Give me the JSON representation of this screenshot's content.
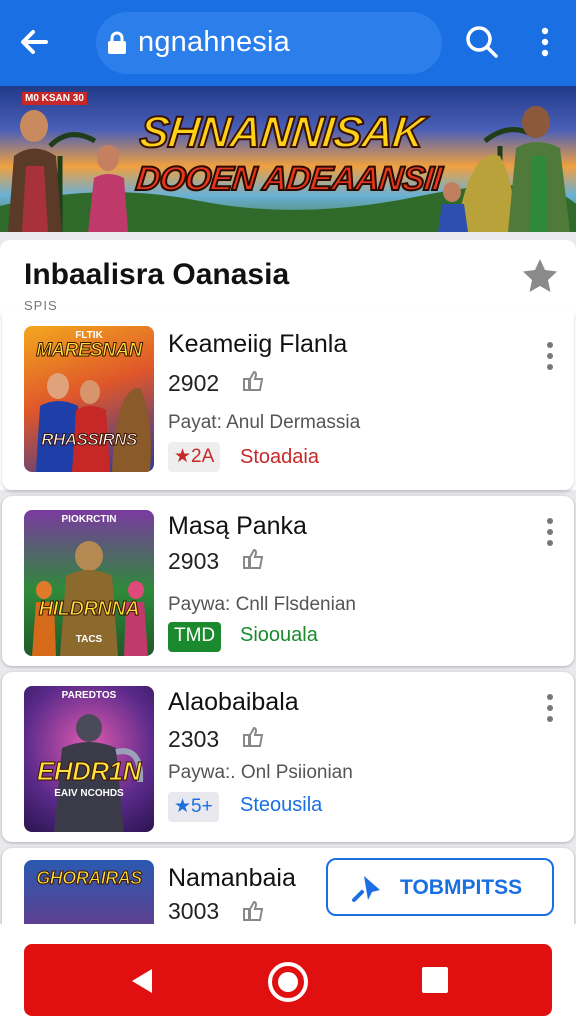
{
  "browser": {
    "url": "ngnahnesia",
    "accent": "#1a6fe2",
    "icons": [
      "back-arrow-icon",
      "lock-icon",
      "search-icon",
      "more-vertical-icon"
    ]
  },
  "banner": {
    "tag": "M0 KSAN 30",
    "line1": "SHNANNISAK",
    "line2": "DOOEN ADEAANSII"
  },
  "section": {
    "title": "Inbaalisra Oanasia",
    "subtitle": "SPIS"
  },
  "items": [
    {
      "name": "Keameiig Flanla",
      "year": "2902",
      "desc": "Payat: Anul Dermassia",
      "badge": "★2A",
      "status": "Stoadaia",
      "status_color": "#c62828",
      "thumb_top": "FLTIK",
      "thumb_mid": "MARESNAN",
      "thumb_bottom": "RHASSIRNS"
    },
    {
      "name": "Masą Panka",
      "year": "2903",
      "desc": "Paywa: Cnll Flsdenian",
      "badge": "TMD",
      "status": "Sioouala",
      "status_color": "#1b8a2e",
      "thumb_top": "PIOKRCTIN",
      "thumb_mid": "HILDRNNA",
      "thumb_bottom": "TACS"
    },
    {
      "name": "Alaobaibala",
      "year": "2303",
      "desc": "Paywa:. Onl Psiionian",
      "badge": "★5+",
      "status": "Steousila",
      "status_color": "#1a6fe2",
      "thumb_top": "PAREDTOS",
      "thumb_mid": "EHDR1N",
      "thumb_bottom": "EAIV NCOHDS"
    },
    {
      "name": "Namanbaia",
      "year": "3003",
      "thumb_top": "GHORAIRAS"
    }
  ],
  "fab": {
    "label": "TOBMPITSS",
    "icon": "pin-icon"
  },
  "navbar": {
    "color": "#e01010",
    "icons": [
      "nav-back-icon",
      "nav-home-icon",
      "nav-recent-icon"
    ]
  }
}
